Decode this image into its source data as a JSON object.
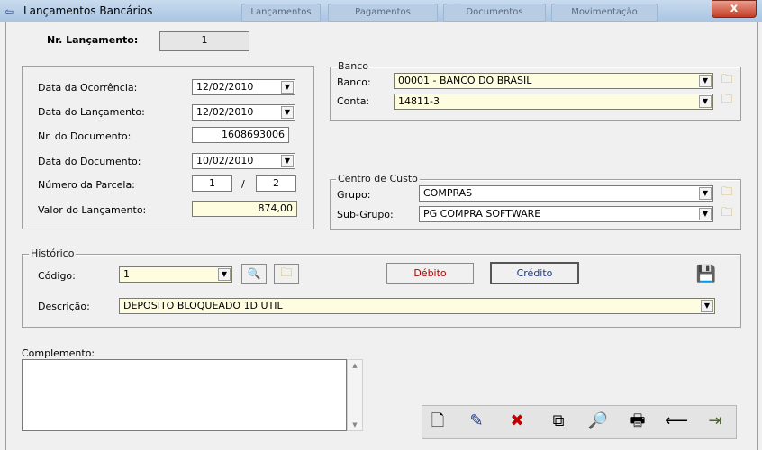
{
  "window": {
    "title": "Lançamentos Bancários",
    "background_tabs": [
      "Lançamentos",
      "Pagamentos",
      "Documentos",
      "Movimentação"
    ],
    "close_label": "x"
  },
  "nr_lancamento": {
    "label": "Nr. Lançamento:",
    "value": "1"
  },
  "dates": {
    "data_ocorrencia": {
      "label": "Data da Ocorrência:",
      "value": "12/02/2010"
    },
    "data_lancamento": {
      "label": "Data do Lançamento:",
      "value": "12/02/2010"
    },
    "nr_documento": {
      "label": "Nr. do Documento:",
      "value": "1608693006"
    },
    "data_documento": {
      "label": "Data do Documento:",
      "value": "10/02/2010"
    },
    "numero_parcela": {
      "label": "Número da Parcela:",
      "value": "1",
      "total": "2",
      "separator": "/"
    },
    "valor_lancamento": {
      "label": "Valor do Lançamento:",
      "value": "874,00"
    }
  },
  "banco": {
    "legend": "Banco",
    "banco_label": "Banco:",
    "banco_value": "00001 - BANCO DO BRASIL",
    "conta_label": "Conta:",
    "conta_value": "14811-3"
  },
  "centro_custo": {
    "legend": "Centro de Custo",
    "grupo_label": "Grupo:",
    "grupo_value": "COMPRAS",
    "subgrupo_label": "Sub-Grupo:",
    "subgrupo_value": "PG COMPRA SOFTWARE"
  },
  "historico": {
    "legend": "Histórico",
    "codigo_label": "Código:",
    "codigo_value": "1",
    "debito_label": "Débito",
    "credito_label": "Crédito",
    "descricao_label": "Descrição:",
    "descricao_value": "DEPOSITO BLOQUEADO 1D UTIL"
  },
  "complemento": {
    "label": "Complemento:",
    "value": ""
  },
  "icons": {
    "dropdown": "▼",
    "folder": "🗀",
    "search": "🔍",
    "save": "💾",
    "new": "🗋",
    "edit": "✎",
    "delete": "✖",
    "copy": "⧉",
    "find": "🔎",
    "print": "🖶",
    "back": "⟵",
    "exit": "⇥",
    "app": "⇦"
  },
  "colors": {
    "title_bar": "#a9c4e2",
    "required_field": "#fffde0",
    "debito_text": "#b00000",
    "credito_text": "#1a3b8a"
  }
}
